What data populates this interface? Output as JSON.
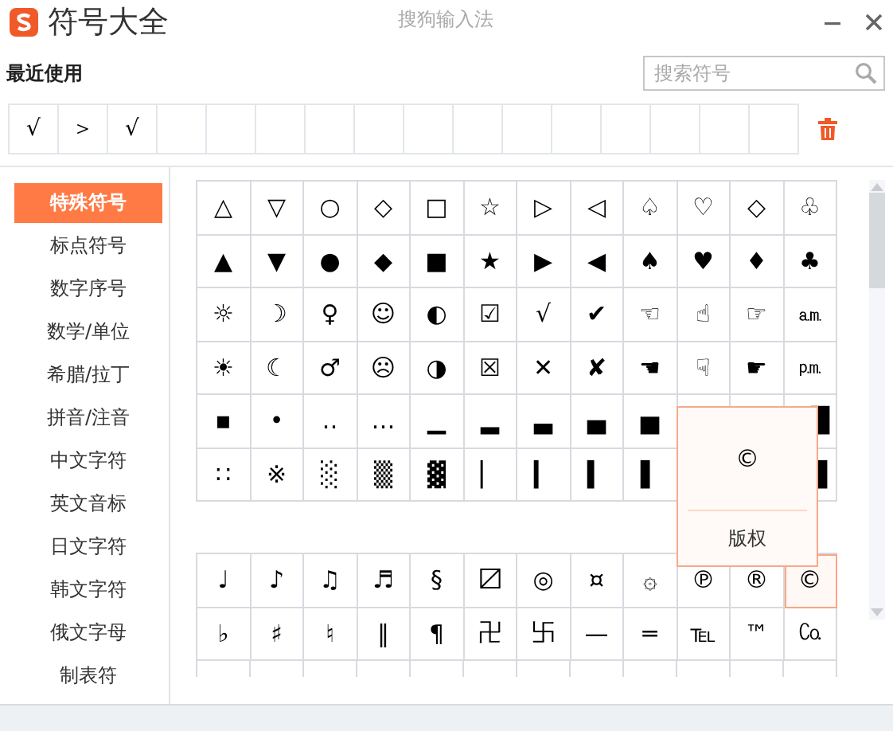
{
  "window": {
    "title": "符号大全",
    "app_name": "搜狗输入法"
  },
  "recent": {
    "label": "最近使用",
    "symbols": [
      "√",
      "＞",
      "√"
    ]
  },
  "search": {
    "placeholder": "搜索符号"
  },
  "categories": [
    {
      "label": "特殊符号",
      "selected": true
    },
    {
      "label": "标点符号",
      "selected": false
    },
    {
      "label": "数字序号",
      "selected": false
    },
    {
      "label": "数学/单位",
      "selected": false
    },
    {
      "label": "希腊/拉丁",
      "selected": false
    },
    {
      "label": "拼音/注音",
      "selected": false
    },
    {
      "label": "中文字符",
      "selected": false
    },
    {
      "label": "英文音标",
      "selected": false
    },
    {
      "label": "日文字符",
      "selected": false
    },
    {
      "label": "韩文字符",
      "selected": false
    },
    {
      "label": "俄文字母",
      "selected": false
    },
    {
      "label": "制表符",
      "selected": false
    }
  ],
  "groups": [
    {
      "rows": [
        [
          "△",
          "▽",
          "○",
          "◇",
          "□",
          "☆",
          "▷",
          "◁",
          "♤",
          "♡",
          "◇",
          "♧"
        ],
        [
          "▲",
          "▼",
          "●",
          "◆",
          "■",
          "★",
          "▶",
          "◀",
          "♠",
          "♥",
          "♦",
          "♣"
        ],
        [
          "☼",
          "☽",
          "♀",
          "☺",
          "◐",
          "☑",
          "√",
          "✔",
          "☜",
          "☝",
          "☞",
          "㏂"
        ],
        [
          "☀",
          "☾",
          "♂",
          "☹",
          "◑",
          "☒",
          "✕",
          "✘",
          "☚",
          "☟",
          "☛",
          "㏘"
        ],
        [
          "▪",
          "•",
          "‥",
          "…",
          "▁",
          "▂",
          "▃",
          "▄",
          "▅",
          null,
          null,
          "█"
        ],
        [
          "∷",
          "※",
          "░",
          "▒",
          "▓",
          "▏",
          "▎",
          "▍",
          "▌",
          null,
          null,
          "▉"
        ]
      ]
    },
    {
      "rows": [
        [
          "♩",
          "♪",
          "♫",
          "♬",
          "§",
          "〼",
          "◎",
          "¤",
          "۞",
          "℗",
          "®",
          {
            "symbol": "©",
            "selected": true
          }
        ],
        [
          "♭",
          "♯",
          "♮",
          "‖",
          "¶",
          "卍",
          "卐",
          "—",
          "═",
          "℡",
          "™",
          "㏇"
        ]
      ]
    }
  ],
  "tooltip": {
    "symbol": "©",
    "name": "版权"
  }
}
